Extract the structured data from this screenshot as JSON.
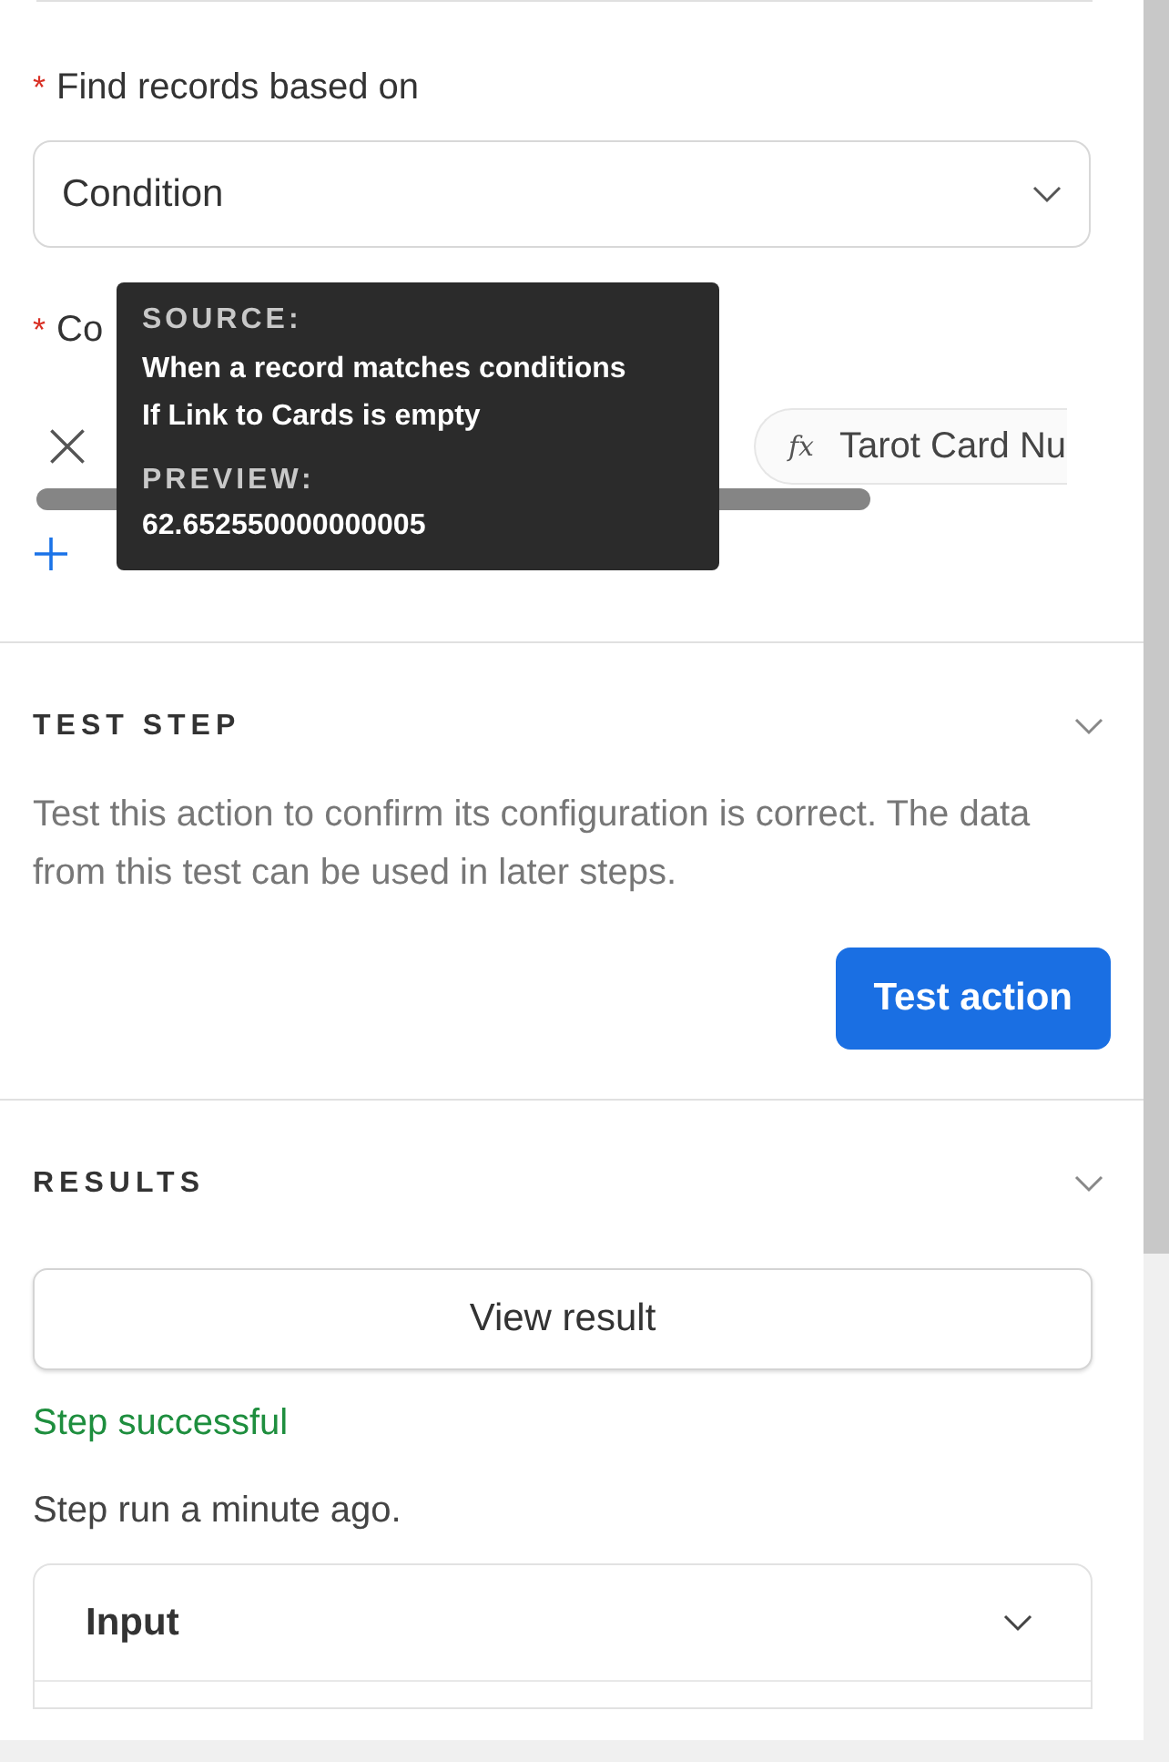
{
  "find_records": {
    "label": "Find records based on",
    "required_mark": "*",
    "value": "Condition"
  },
  "conditions": {
    "label": "Co",
    "required_mark": "*",
    "chip": {
      "icon": "fx",
      "text": "Tarot Card Nu"
    }
  },
  "tooltip": {
    "source_label": "SOURCE:",
    "source_lines": [
      "When a record matches conditions",
      "If Link to Cards is empty"
    ],
    "preview_label": "PREVIEW:",
    "preview_value": "62.652550000000005"
  },
  "test_step": {
    "title": "TEST STEP",
    "expanded": true,
    "description": "Test this action to confirm its configuration is correct. The data from this test can be used in later steps.",
    "button": "Test action"
  },
  "results": {
    "title": "RESULTS",
    "expanded": true,
    "view_button": "View result",
    "status": "Step successful",
    "run_time": "Step run a minute ago.",
    "panels": [
      {
        "title": "Input",
        "expanded": false
      }
    ]
  }
}
